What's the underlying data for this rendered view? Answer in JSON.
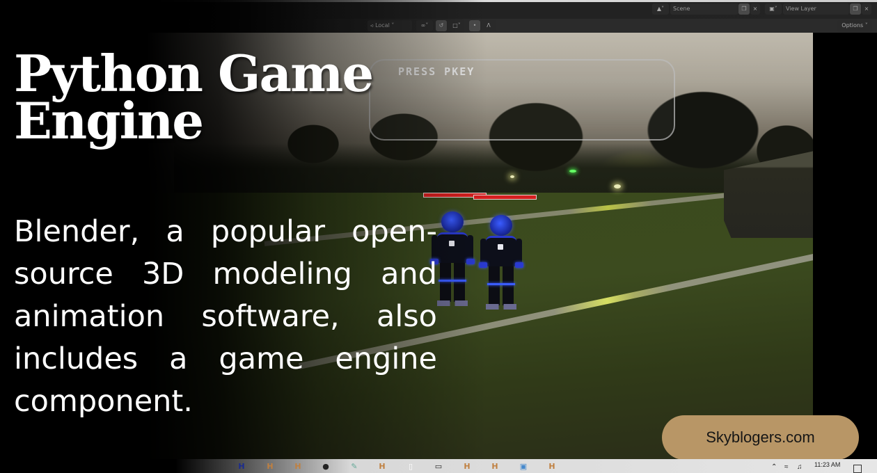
{
  "blender_header": {
    "scene_label": "Scene",
    "view_layer_label": "View Layer",
    "options_label": "Options",
    "transform_orientation": "Local",
    "icons": [
      "scene-icon",
      "new-scene-icon",
      "close-icon",
      "view-layer-icon",
      "new-view-layer-icon",
      "close-icon",
      "transform-orientation-icon",
      "pivot-icon",
      "snap-icon",
      "snap-target-icon",
      "proportional-edit-icon",
      "falloff-icon"
    ]
  },
  "game": {
    "hud_message": "PRESS PKEY",
    "health_bars": [
      {
        "player": 1,
        "health_fraction": 1.0
      },
      {
        "player": 2,
        "health_fraction": 1.0
      }
    ],
    "characters": [
      "player-1",
      "player-2"
    ],
    "colors": {
      "health": "#d61f1f",
      "character_glow": "#3a5cff",
      "light": "#ffff80"
    }
  },
  "overlay": {
    "headline_line1": "Python Game",
    "headline_line2": "Engine",
    "body": "Blender, a popular open-source 3D modeling and animation software, also includes a game engine component.",
    "site": "Skyblogers.com",
    "pill_color": "#b89666"
  },
  "taskbar": {
    "apps": [
      "blender-icon-blue",
      "blender-icon",
      "blender-icon",
      "obs-icon",
      "paint-icon",
      "blender-icon",
      "file-icon",
      "vr-icon",
      "blender-icon",
      "blender-icon",
      "screen-icon",
      "blender-icon"
    ],
    "tray_icons": [
      "chevron-up-icon",
      "wifi-icon",
      "volume-icon"
    ],
    "clock": "11:23 AM"
  }
}
